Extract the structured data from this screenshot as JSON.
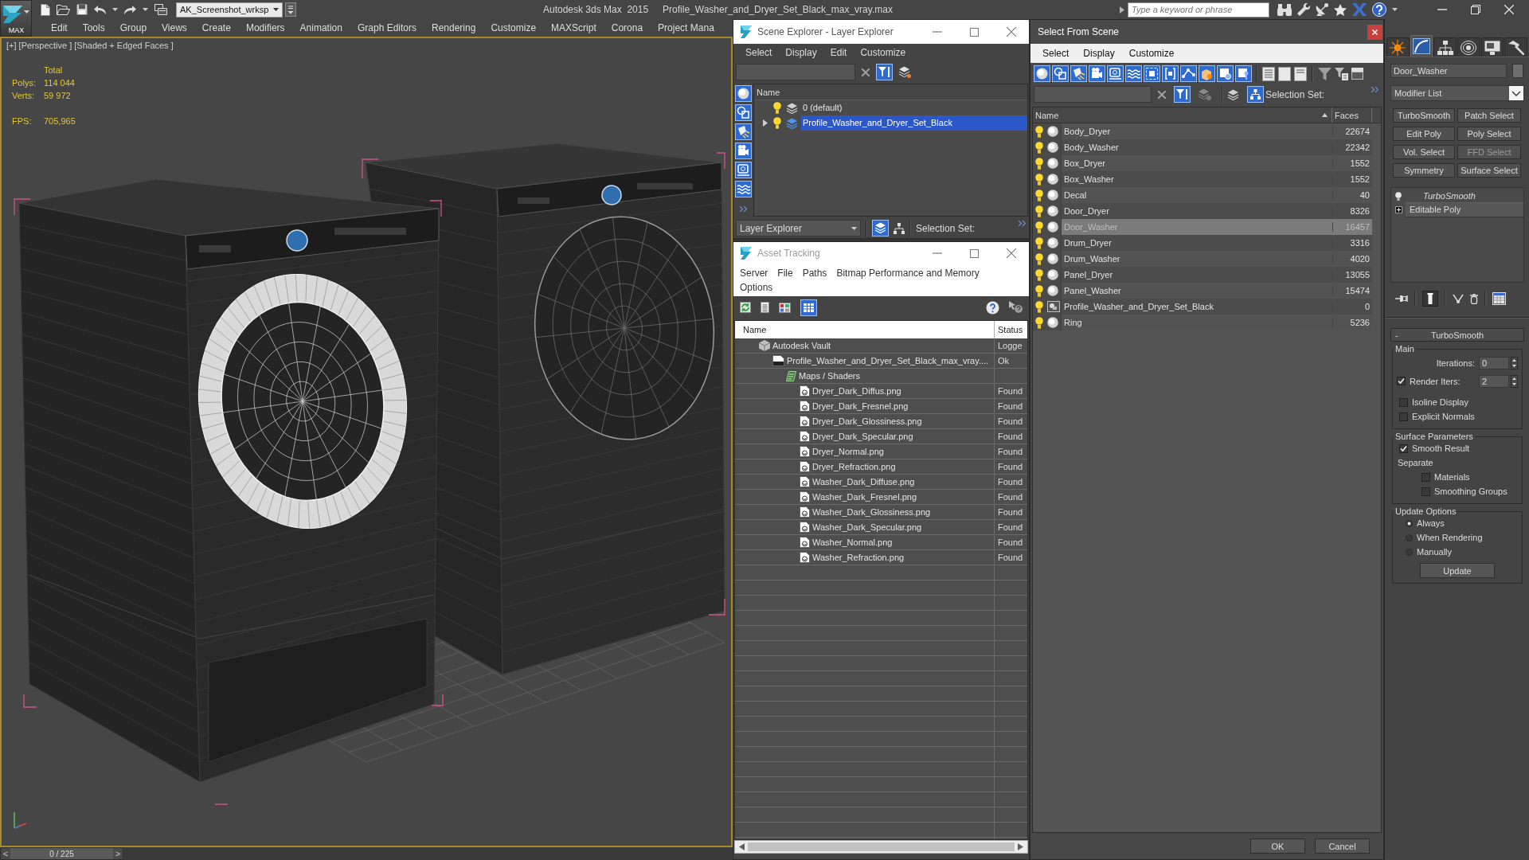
{
  "title_bar": {
    "logo_text": "MAX",
    "workspace": "AK_Screenshot_wrksp",
    "app_title": "Autodesk 3ds Max  2015",
    "file_title": "Profile_Washer_and_Dryer_Set_Black_max_vray.max",
    "search": {
      "placeholder": "Type a keyword or phrase"
    }
  },
  "menu_bar": {
    "items": [
      "Edit",
      "Tools",
      "Group",
      "Views",
      "Create",
      "Modifiers",
      "Animation",
      "Graph Editors",
      "Rendering",
      "Customize",
      "MAXScript",
      "Corona",
      "Project Mana"
    ]
  },
  "viewport": {
    "active": true,
    "label": "[+] [Perspective ] [Shaded + Edged Faces ]",
    "stats": {
      "heading": "Total",
      "counts": [
        {
          "label": "Polys:",
          "value": "114 044"
        },
        {
          "label": "Verts:",
          "value": "59 972"
        }
      ],
      "fps": {
        "label": "FPS:",
        "value": "705,965"
      }
    }
  },
  "time_slider": {
    "level": 0,
    "prev": "<",
    "position": "0 / 225",
    "next": ">"
  },
  "scene_explorer": {
    "title": "Scene Explorer - Layer Explorer",
    "menu": [
      "Select",
      "Display",
      "Edit",
      "Customize"
    ],
    "column": "Name",
    "layers": [
      {
        "name": "0 (default)",
        "collapsed": false,
        "current": false,
        "selected": false
      },
      {
        "name": "Profile_Washer_and_Dryer_Set_Black",
        "collapsed": true,
        "current": true,
        "selected": true
      }
    ],
    "explorer_mode": "Layer Explorer",
    "selection_set_label": "Selection Set:"
  },
  "asset_tracking": {
    "title": "Asset Tracking",
    "menu": [
      "Server",
      "File",
      "Paths",
      "Bitmap Performance and Memory",
      "Options"
    ],
    "columns": [
      "Name",
      "Status"
    ],
    "assets": [
      {
        "kind": "vault",
        "name": "Autodesk Vault",
        "status": "Logge",
        "children": [
          {
            "kind": "scene-file",
            "name": "Profile_Washer_and_Dryer_Set_Black_max_vray....",
            "status": "Ok",
            "children": [
              {
                "kind": "folder",
                "name": "Maps / Shaders",
                "children": [
                  {
                    "kind": "bitmap",
                    "name": "Dryer_Dark_Diffus.png",
                    "status": "Found"
                  },
                  {
                    "kind": "bitmap",
                    "name": "Dryer_Dark_Fresnel.png",
                    "status": "Found"
                  },
                  {
                    "kind": "bitmap",
                    "name": "Dryer_Dark_Glossiness.png",
                    "status": "Found"
                  },
                  {
                    "kind": "bitmap",
                    "name": "Dryer_Dark_Specular.png",
                    "status": "Found"
                  },
                  {
                    "kind": "bitmap",
                    "name": "Dryer_Normal.png",
                    "status": "Found"
                  },
                  {
                    "kind": "bitmap",
                    "name": "Dryer_Refraction.png",
                    "status": "Found"
                  },
                  {
                    "kind": "bitmap",
                    "name": "Washer_Dark_Diffuse.png",
                    "status": "Found"
                  },
                  {
                    "kind": "bitmap",
                    "name": "Washer_Dark_Fresnel.png",
                    "status": "Found"
                  },
                  {
                    "kind": "bitmap",
                    "name": "Washer_Dark_Glossiness.png",
                    "status": "Found"
                  },
                  {
                    "kind": "bitmap",
                    "name": "Washer_Dark_Specular.png",
                    "status": "Found"
                  },
                  {
                    "kind": "bitmap",
                    "name": "Washer_Normal.png",
                    "status": "Found"
                  },
                  {
                    "kind": "bitmap",
                    "name": "Washer_Refraction.png",
                    "status": "Found"
                  }
                ]
              }
            ]
          }
        ]
      }
    ]
  },
  "select_from_scene": {
    "title": "Select From Scene",
    "menu": [
      "Select",
      "Display",
      "Customize"
    ],
    "selection_set_label": "Selection Set:",
    "columns": [
      {
        "label": "Name",
        "sorted": true
      },
      {
        "label": "Faces",
        "sorted": false
      }
    ],
    "objects": [
      {
        "name": "Body_Dryer",
        "faces": "22674",
        "kind": "geometry",
        "selected": false
      },
      {
        "name": "Body_Washer",
        "faces": "22342",
        "kind": "geometry",
        "selected": false
      },
      {
        "name": "Box_Dryer",
        "faces": "1552",
        "kind": "geometry",
        "selected": false
      },
      {
        "name": "Box_Washer",
        "faces": "1552",
        "kind": "geometry",
        "selected": false
      },
      {
        "name": "Decal",
        "faces": "40",
        "kind": "geometry",
        "selected": false
      },
      {
        "name": "Door_Dryer",
        "faces": "8326",
        "kind": "geometry",
        "selected": false
      },
      {
        "name": "Door_Washer",
        "faces": "16457",
        "kind": "geometry",
        "selected": true
      },
      {
        "name": "Drum_Dryer",
        "faces": "3316",
        "kind": "geometry",
        "selected": false
      },
      {
        "name": "Drum_Washer",
        "faces": "4020",
        "kind": "geometry",
        "selected": false
      },
      {
        "name": "Panel_Dryer",
        "faces": "13055",
        "kind": "geometry",
        "selected": false
      },
      {
        "name": "Panel_Washer",
        "faces": "15474",
        "kind": "geometry",
        "selected": false
      },
      {
        "name": "Profile_Washer_and_Dryer_Set_Black",
        "faces": "0",
        "kind": "group",
        "selected": false
      },
      {
        "name": "Ring",
        "faces": "5236",
        "kind": "geometry",
        "selected": false
      }
    ],
    "buttons": [
      "OK",
      "Cancel"
    ]
  },
  "command_panel": {
    "tabs": [
      {
        "kind": "create",
        "selected": false
      },
      {
        "kind": "modify",
        "selected": true
      },
      {
        "kind": "hierarchy",
        "selected": false
      },
      {
        "kind": "motion",
        "selected": false
      },
      {
        "kind": "display",
        "selected": false
      },
      {
        "kind": "utilities",
        "selected": false
      }
    ],
    "object_name": "Door_Washer",
    "modifier_list": "Modifier List",
    "modifier_buttons": [
      {
        "label": "TurboSmooth",
        "disabled": false
      },
      {
        "label": "Patch Select",
        "disabled": false
      },
      {
        "label": "Edit Poly",
        "disabled": false
      },
      {
        "label": "Poly Select",
        "disabled": false
      },
      {
        "label": "Vol. Select",
        "disabled": false
      },
      {
        "label": "FFD Select",
        "disabled": true
      },
      {
        "label": "Symmetry",
        "disabled": false
      },
      {
        "label": "Surface Select",
        "disabled": false
      }
    ],
    "stack": [
      {
        "name": "TurboSmooth",
        "kind": "modifier",
        "viewport_off": true,
        "collapsed": false
      },
      {
        "name": "Editable Poly",
        "kind": "base",
        "viewport_off": false,
        "collapsed": true
      }
    ],
    "rollout": {
      "toggle": "-",
      "title": "TurboSmooth",
      "groups": [
        {
          "title": "Main",
          "controls": [
            {
              "kind": "spinner",
              "label": "Iterations:",
              "value": "0"
            },
            {
              "kind": "checked-spinner",
              "label": "Render Iters:",
              "checked": true,
              "value": "2"
            },
            {
              "kind": "checkbox",
              "label": "Isoline Display",
              "checked": false
            },
            {
              "kind": "checkbox",
              "label": "Explicit Normals",
              "checked": false
            }
          ]
        },
        {
          "title": "Surface Parameters",
          "controls": [
            {
              "kind": "checkbox",
              "label": "Smooth Result",
              "checked": true
            },
            {
              "kind": "label",
              "label": "Separate",
              "children": [
                {
                  "kind": "checkbox",
                  "label": "Materials",
                  "checked": false
                },
                {
                  "kind": "checkbox",
                  "label": "Smoothing Groups",
                  "checked": false
                }
              ]
            }
          ]
        },
        {
          "title": "Update Options",
          "controls": [
            {
              "kind": "radio",
              "label": "Always",
              "selected": true
            },
            {
              "kind": "radio",
              "label": "When Rendering",
              "selected": false
            },
            {
              "kind": "radio",
              "label": "Manually",
              "selected": false
            },
            {
              "kind": "button",
              "label": "Update"
            }
          ]
        }
      ]
    }
  }
}
